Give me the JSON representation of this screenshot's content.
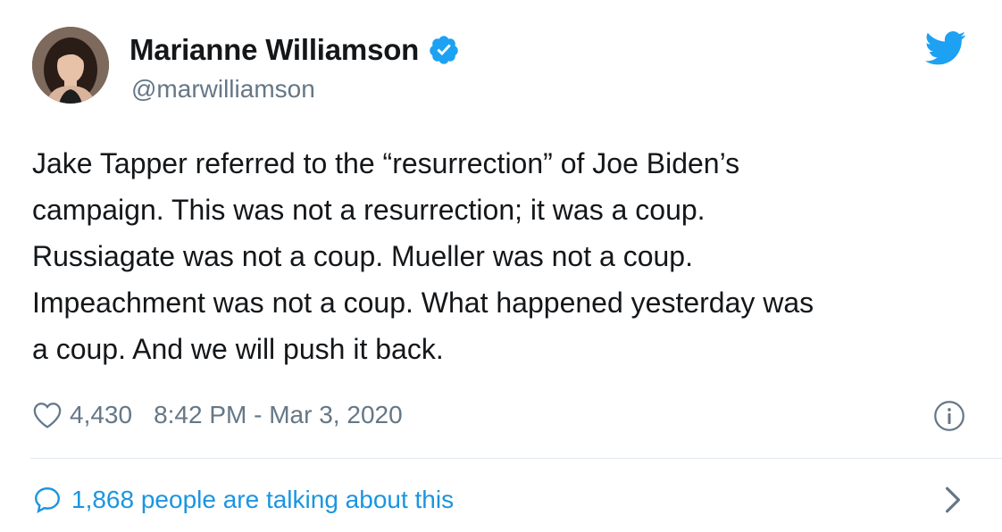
{
  "author": {
    "display_name": "Marianne Williamson",
    "handle": "@marwilliamson",
    "verified": true
  },
  "tweet": {
    "text": "Jake Tapper referred to the “resurrection” of Joe Biden’s\ncampaign. This was not a resurrection; it was a coup.\nRussiagate was not a coup. Mueller was not a coup.\nImpeachment was not a coup. What happened yesterday was\na coup. And we will push it back.",
    "likes": "4,430",
    "timestamp": "8:42 PM - Mar 3, 2020"
  },
  "footer": {
    "talking_label": "1,868 people are talking about this"
  },
  "colors": {
    "twitter_blue": "#1da1f2",
    "link_blue": "#1b95e0",
    "secondary_text": "#657786",
    "divider": "#e1e8ed"
  },
  "icons": [
    "verified-badge-icon",
    "twitter-bird-icon",
    "heart-icon",
    "info-icon",
    "speech-bubble-icon",
    "chevron-right-icon"
  ]
}
